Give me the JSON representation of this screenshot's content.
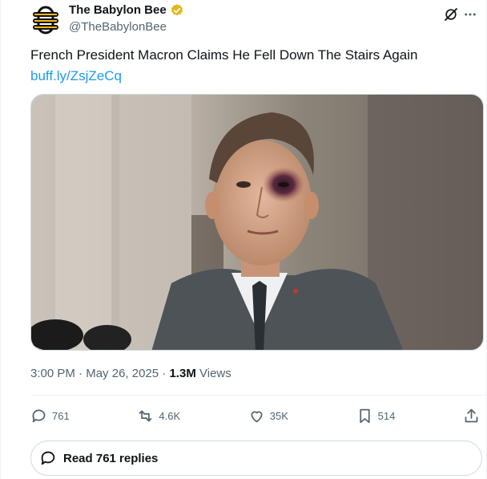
{
  "author": {
    "display_name": "The Babylon Bee",
    "handle": "@TheBabylonBee",
    "avatar_icon": "bee-logo-icon",
    "verified_icon": "verified-badge-icon",
    "verified_color": "#e2b719"
  },
  "tweet": {
    "text": "French President Macron Claims He Fell Down The Stairs Again",
    "link_text": "buff.ly/ZsjZeCq",
    "link_color": "#1d9bf0"
  },
  "meta": {
    "time": "3:00 PM",
    "separator": "·",
    "date": "May 26, 2025",
    "views_count": "1.3M",
    "views_label": "Views"
  },
  "actions": {
    "replies": "761",
    "reposts": "4.6K",
    "likes": "35K",
    "bookmarks": "514"
  },
  "read_replies": {
    "label": "Read 761 replies"
  }
}
